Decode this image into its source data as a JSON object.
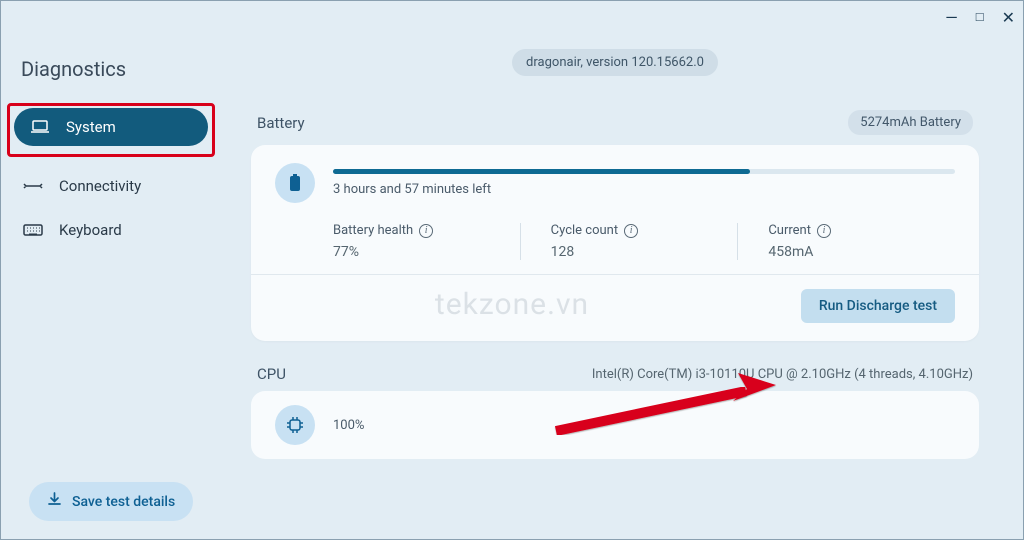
{
  "app": {
    "title": "Diagnostics"
  },
  "nav": {
    "system": "System",
    "connectivity": "Connectivity",
    "keyboard": "Keyboard"
  },
  "sidebar": {
    "save": "Save test details"
  },
  "header": {
    "version": "dragonair, version 120.15662.0"
  },
  "battery": {
    "title": "Battery",
    "chip": "5274mAh Battery",
    "time_left": "3 hours and 57 minutes left",
    "progress_pct": 67,
    "health_label": "Battery health",
    "health_val": "77%",
    "cycle_label": "Cycle count",
    "cycle_val": "128",
    "current_label": "Current",
    "current_val": "458mA",
    "run_btn": "Run Discharge test"
  },
  "cpu": {
    "title": "CPU",
    "info": "Intel(R) Core(TM) i3-10110U CPU @ 2.10GHz (4 threads, 4.10GHz)",
    "usage": "100%"
  },
  "watermark": "tekzone.vn"
}
